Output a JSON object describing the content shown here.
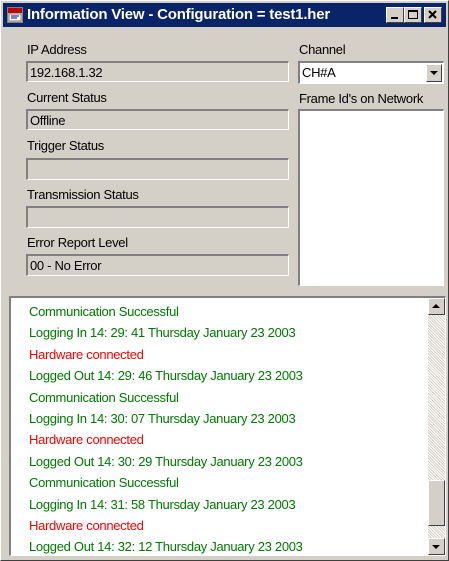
{
  "window": {
    "title": "Information View - Configuration = test1.her"
  },
  "fields": {
    "ip_label": "IP Address",
    "ip_value": "192.168.1.32",
    "current_status_label": "Current Status",
    "current_status_value": "Offline",
    "trigger_status_label": "Trigger Status",
    "trigger_status_value": "",
    "transmission_status_label": "Transmission Status",
    "transmission_status_value": "",
    "error_report_label": "Error Report Level",
    "error_report_value": "00 - No Error"
  },
  "channel": {
    "label": "Channel",
    "value": "CH#A"
  },
  "frames": {
    "label": "Frame Id's on Network",
    "items": []
  },
  "log": [
    {
      "text": "Communication Successful",
      "color": "#007a00"
    },
    {
      "text": "Logging In 14: 29: 41  Thursday January 23 2003",
      "color": "#007a00"
    },
    {
      "text": "Hardware connected",
      "color": "#ff0000"
    },
    {
      "text": "Logged Out 14: 29: 46  Thursday January 23 2003",
      "color": "#007a00"
    },
    {
      "text": "Communication Successful",
      "color": "#007a00"
    },
    {
      "text": "Logging In 14: 30: 07  Thursday January 23 2003",
      "color": "#007a00"
    },
    {
      "text": "Hardware connected",
      "color": "#ff0000"
    },
    {
      "text": "Logged Out 14: 30: 29  Thursday January 23 2003",
      "color": "#007a00"
    },
    {
      "text": "Communication Successful",
      "color": "#007a00"
    },
    {
      "text": "Logging In 14: 31: 58  Thursday January 23 2003",
      "color": "#007a00"
    },
    {
      "text": "Hardware connected",
      "color": "#ff0000"
    },
    {
      "text": "Logged Out 14: 32: 12  Thursday January 23 2003",
      "color": "#007a00"
    }
  ],
  "log_scroll_position": 0.93
}
